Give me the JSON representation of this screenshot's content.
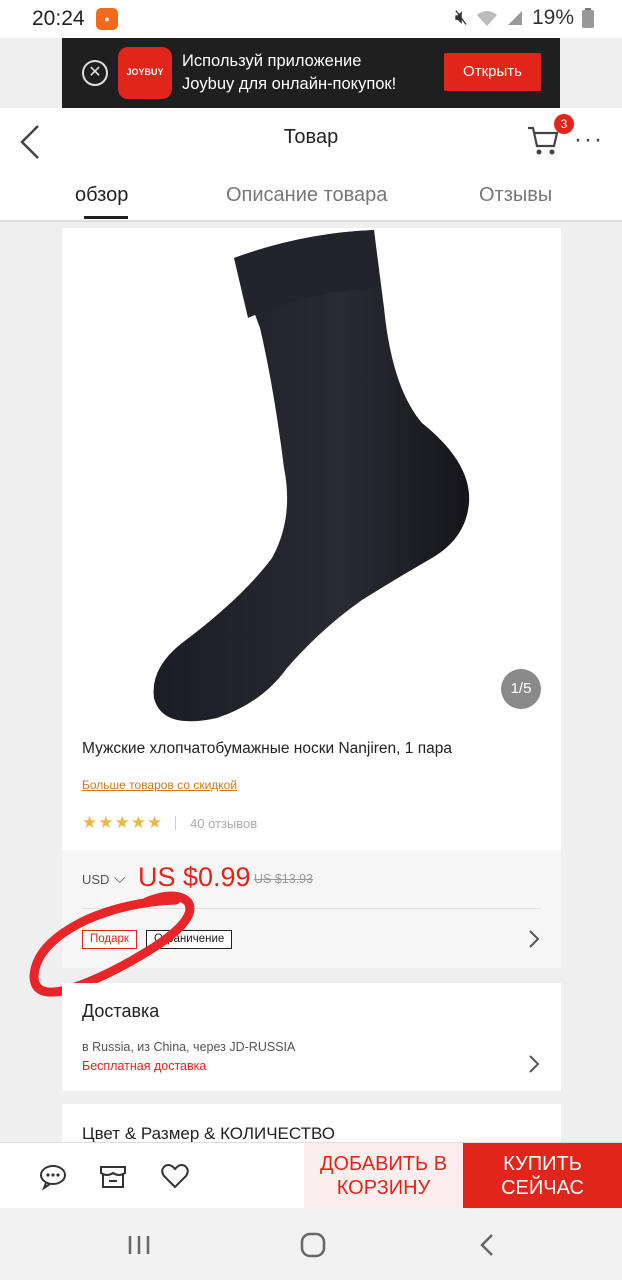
{
  "status_bar": {
    "time": "20:24",
    "battery": "19%"
  },
  "app_banner": {
    "logo_text": "JOYBUY",
    "message_line1": "Используй приложение",
    "message_line2": "Joybuy для онлайн-покупок!",
    "open_button": "Открыть"
  },
  "header": {
    "title": "Товар",
    "cart_count": "3",
    "tabs": [
      {
        "label": "обзор",
        "active": true
      },
      {
        "label": "Описание товара",
        "active": false
      },
      {
        "label": "Отзывы",
        "active": false
      }
    ]
  },
  "product": {
    "image_counter": "1/5",
    "title": "Мужские хлопчатобумажные носки Nanjiren, 1 пара",
    "promo_link": "Больше товаров со скидкой",
    "rating": 5,
    "reviews": "40 отзывов"
  },
  "price": {
    "currency": "USD",
    "current": "US $0.99",
    "old": "US $13.93",
    "tags": [
      "Подарк",
      "Ограничение"
    ]
  },
  "delivery": {
    "title": "Доставка",
    "route": "в Russia, из China, через JD-RUSSIA",
    "free": "Бесплатная доставка"
  },
  "variants": {
    "title": "Цвет & Размер & КОЛИЧЕСТВО"
  },
  "actions": {
    "add_to_cart_line1": "ДОБАВИТЬ В",
    "add_to_cart_line2": "КОРЗИНУ",
    "buy_now_line1": "КУПИТЬ",
    "buy_now_line2": "СЕЙЧАС"
  },
  "colors": {
    "accent": "#e1251b",
    "star": "#e8b74c",
    "promo": "#c87b1e"
  }
}
